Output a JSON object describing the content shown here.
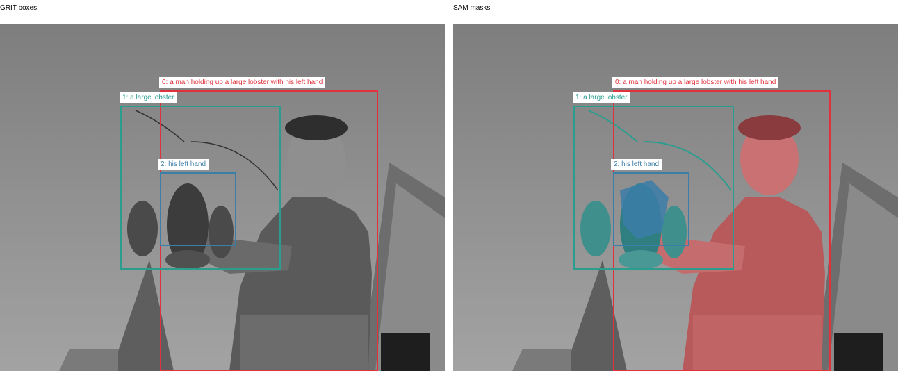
{
  "panels": [
    {
      "title": "GRIT boxes"
    },
    {
      "title": "SAM masks"
    }
  ],
  "regions": [
    {
      "id": 0,
      "label": "0: a man holding up a large lobster with his left hand",
      "color": "#e0323c"
    },
    {
      "id": 1,
      "label": "1: a large lobster",
      "color": "#2a9d8f"
    },
    {
      "id": 2,
      "label": "2: his left hand",
      "color": "#3b7ea8"
    }
  ],
  "photo_description_icon": "lobster-man-photo"
}
